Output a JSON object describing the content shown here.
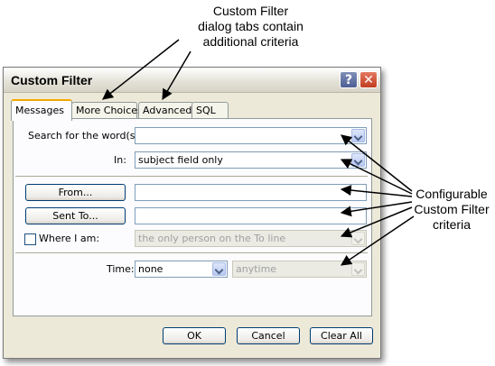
{
  "callouts": {
    "tabs_note": [
      "Custom Filter",
      "dialog tabs contain",
      "additional criteria"
    ],
    "criteria_note": [
      "Configurable",
      "Custom Filter",
      "criteria"
    ]
  },
  "dialog": {
    "title": "Custom Filter",
    "help_symbol": "?",
    "close_symbol": "✕",
    "tabs": [
      "Messages",
      "More Choices",
      "Advanced",
      "SQL"
    ],
    "active_tab": "Messages",
    "search_label": "Search for the word(s):",
    "search_value": "",
    "in_label": "In:",
    "in_value": "subject field only",
    "from_button": "From...",
    "from_value": "",
    "sent_to_button": "Sent To...",
    "sent_to_value": "",
    "where_label": "Where I am:",
    "where_checked": false,
    "where_value": "the only person on the To line",
    "time_label": "Time:",
    "time_value": "none",
    "time_range_value": "anytime",
    "ok_button": "OK",
    "cancel_button": "Cancel",
    "clear_all_button": "Clear All"
  },
  "colors": {
    "window_bg": "#ece9d8",
    "panel_bg": "#fcfcfe",
    "active_tab_accent": "#f7a800",
    "field_border": "#7f9db9",
    "button_border": "#003c74",
    "close_button": "#c13c1f"
  }
}
